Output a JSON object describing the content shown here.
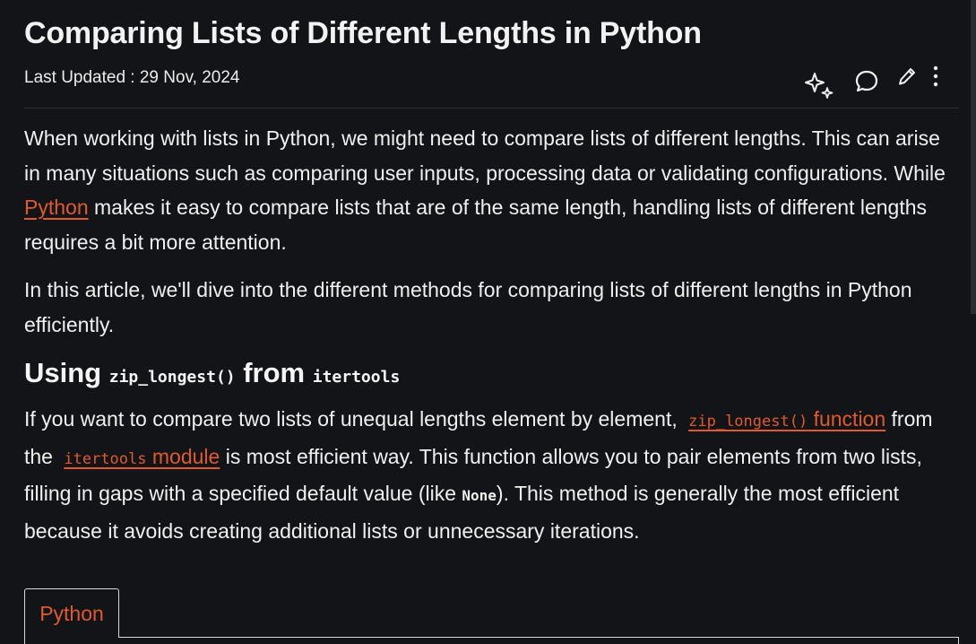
{
  "article": {
    "title": "Comparing Lists of Different Lengths in Python",
    "last_updated": "Last Updated : 29 Nov, 2024"
  },
  "icons": {
    "ai": "sparkle-icon",
    "comment": "comment-icon",
    "edit": "pencil-icon",
    "more": "kebab-menu-icon"
  },
  "intro": {
    "p1_before_link": "When working with lists in Python, we might need to compare lists of different lengths. This can arise in many situations such as comparing user inputs, processing data or validating configurations. While ",
    "p1_link": "Python",
    "p1_after_link": " makes it easy to compare lists that are of the same length, handling lists of different lengths requires a bit more attention.",
    "p2": "In this article, we'll dive into the different methods for comparing lists of different lengths in Python efficiently."
  },
  "section": {
    "heading_prefix": "Using ",
    "heading_code1": "zip_longest()",
    "heading_mid": " from ",
    "heading_code2": "itertools",
    "t1": "If you want to compare two lists of unequal lengths element by element, ",
    "link1_code": "zip_longest()",
    "link1_text": " function",
    "t2": " from the ",
    "link2_code": "itertools",
    "link2_text": " module",
    "t3": " is most efficient way. This function allows you to pair elements from two lists, filling in gaps with a specified default value (like ",
    "t3_code": "None",
    "t4": "). This method is generally the most efficient because it avoids creating additional lists or unnecessary iterations."
  },
  "code": {
    "tab_label": "Python"
  },
  "colors": {
    "background": "#131417",
    "link": "#e05a2b",
    "text": "#f0f0f0"
  }
}
